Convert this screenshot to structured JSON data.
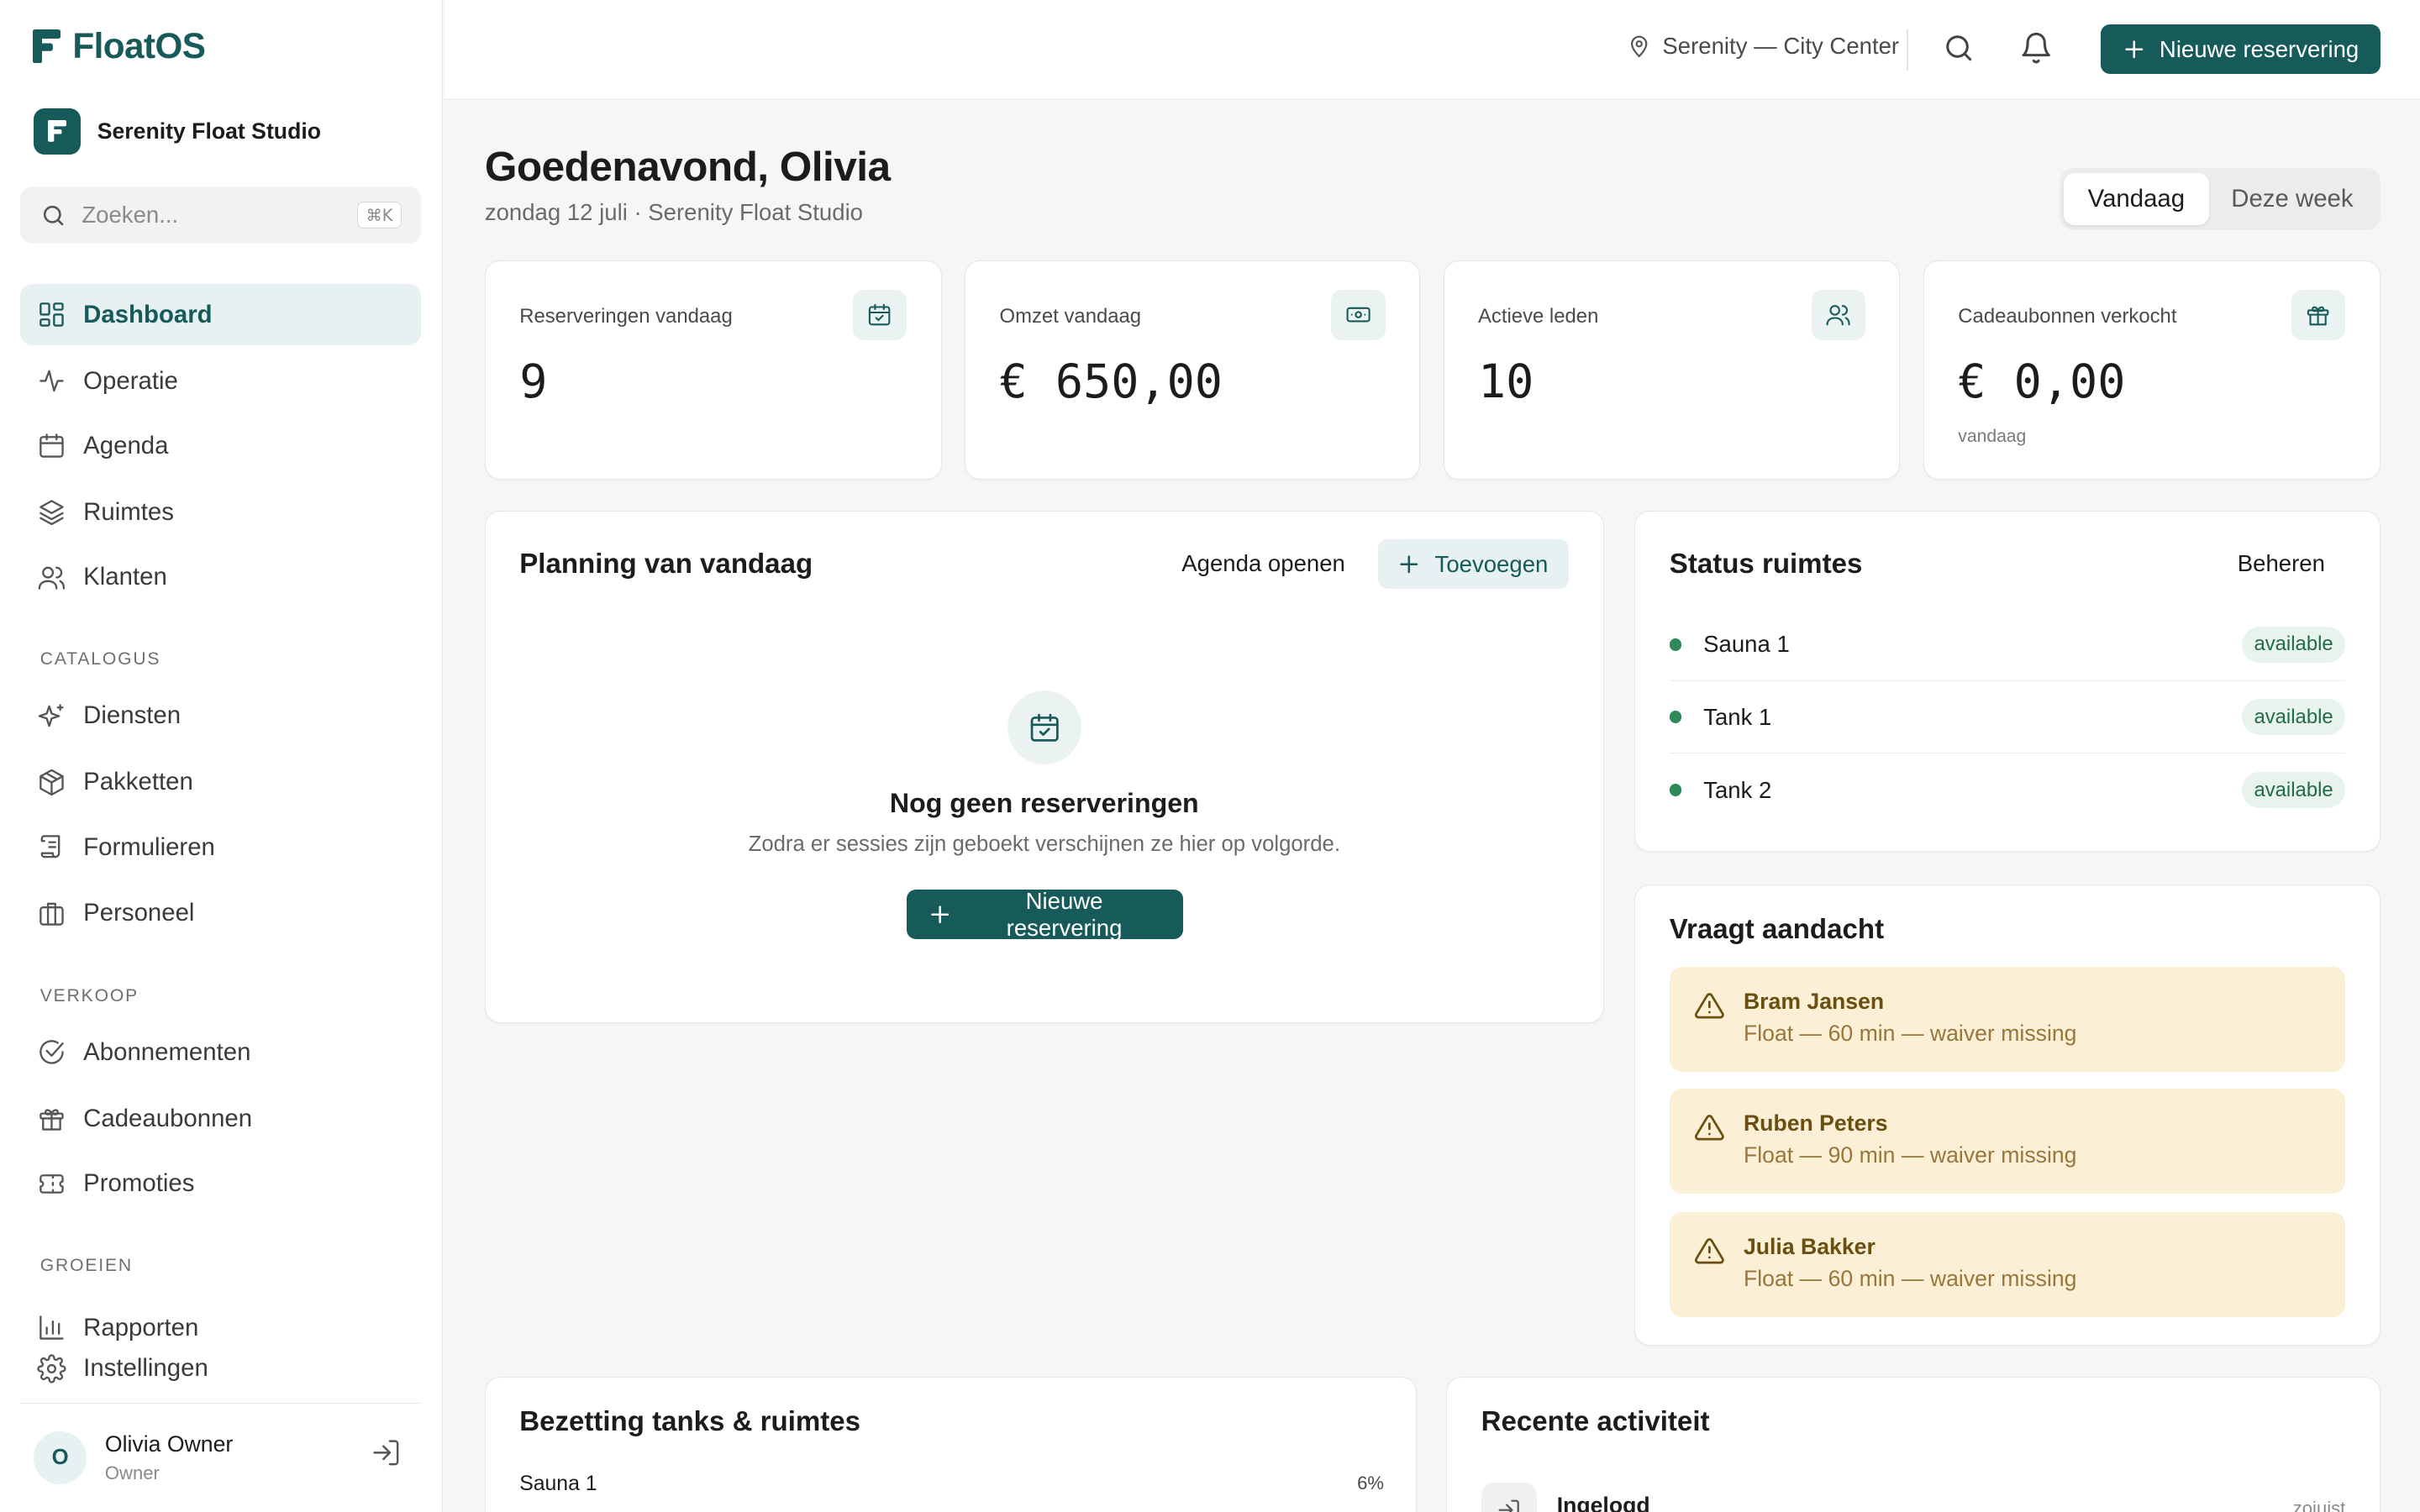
{
  "brand": {
    "name": "FloatOS",
    "accent": "#175a5a"
  },
  "studio": {
    "initial": "F",
    "name": "Serenity Float Studio"
  },
  "search": {
    "placeholder": "Zoeken...",
    "shortcut": "⌘K"
  },
  "nav": {
    "main": [
      {
        "label": "Dashboard",
        "icon": "dashboard-icon",
        "active": true
      },
      {
        "label": "Operatie",
        "icon": "activity-icon"
      },
      {
        "label": "Agenda",
        "icon": "calendar-icon"
      },
      {
        "label": "Ruimtes",
        "icon": "layers-icon"
      },
      {
        "label": "Klanten",
        "icon": "users-icon"
      }
    ],
    "catalogus_label": "CATALOGUS",
    "catalogus": [
      {
        "label": "Diensten",
        "icon": "sparkles-icon"
      },
      {
        "label": "Pakketten",
        "icon": "package-icon"
      },
      {
        "label": "Formulieren",
        "icon": "scroll-icon"
      },
      {
        "label": "Personeel",
        "icon": "briefcase-icon"
      }
    ],
    "verkoop_label": "VERKOOP",
    "verkoop": [
      {
        "label": "Abonnementen",
        "icon": "check-circle-icon"
      },
      {
        "label": "Cadeaubonnen",
        "icon": "gift-icon"
      },
      {
        "label": "Promoties",
        "icon": "ticket-icon"
      }
    ],
    "groeien_label": "GROEIEN",
    "groeien": [
      {
        "label": "Rapporten",
        "icon": "bar-chart-icon"
      },
      {
        "label": "Instellingen",
        "icon": "gear-icon"
      }
    ]
  },
  "user": {
    "initial": "O",
    "name": "Olivia Owner",
    "role": "Owner"
  },
  "topbar": {
    "location": "Serenity — City Center",
    "new_booking": "Nieuwe reservering"
  },
  "header": {
    "greeting": "Goedenavond, Olivia",
    "subtitle": "zondag 12 juli · Serenity Float Studio",
    "range": [
      "Vandaag",
      "Deze week"
    ]
  },
  "stats": [
    {
      "label": "Reserveringen vandaag",
      "value": "9",
      "icon": "calendar-check-icon",
      "sub": ""
    },
    {
      "label": "Omzet vandaag",
      "value": "€ 650,00",
      "icon": "banknote-icon",
      "sub": ""
    },
    {
      "label": "Actieve leden",
      "value": "10",
      "icon": "users-icon",
      "sub": ""
    },
    {
      "label": "Cadeaubonnen verkocht",
      "value": "€ 0,00",
      "icon": "gift-icon",
      "sub": "vandaag"
    }
  ],
  "planning": {
    "title": "Planning van vandaag",
    "open_agenda": "Agenda openen",
    "add": "Toevoegen",
    "empty_title": "Nog geen reserveringen",
    "empty_sub": "Zodra er sessies zijn geboekt verschijnen ze hier op volgorde.",
    "empty_cta": "Nieuwe reservering"
  },
  "rooms": {
    "title": "Status ruimtes",
    "manage": "Beheren",
    "status_color": "#2f8a5a",
    "items": [
      {
        "name": "Sauna 1",
        "status": "available"
      },
      {
        "name": "Tank 1",
        "status": "available"
      },
      {
        "name": "Tank 2",
        "status": "available"
      }
    ]
  },
  "attention": {
    "title": "Vraagt aandacht",
    "items": [
      {
        "name": "Bram Jansen",
        "desc": "Float — 60 min — waiver missing"
      },
      {
        "name": "Ruben Peters",
        "desc": "Float — 90 min — waiver missing"
      },
      {
        "name": "Julia Bakker",
        "desc": "Float — 60 min — waiver missing"
      }
    ]
  },
  "occupancy": {
    "title": "Bezetting tanks & ruimtes",
    "rows": [
      {
        "name": "Sauna 1",
        "pct": "6%"
      }
    ]
  },
  "activity": {
    "title": "Recente activiteit",
    "items": [
      {
        "label": "Ingelogd",
        "time": "zojuist"
      }
    ]
  }
}
